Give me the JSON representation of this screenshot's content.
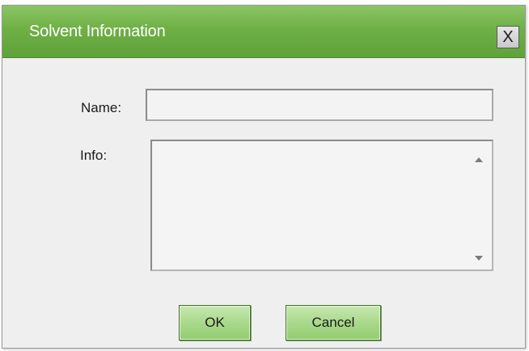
{
  "dialog": {
    "title": "Solvent Information",
    "close_label": "X"
  },
  "form": {
    "name_label": "Name:",
    "name_value": "",
    "info_label": "Info:",
    "info_value": ""
  },
  "buttons": {
    "ok_label": "OK",
    "cancel_label": "Cancel"
  },
  "colors": {
    "titlebar": "#6fb046",
    "button": "#a9d98b",
    "dialog_bg": "#efefef"
  },
  "icons": {
    "scroll_up": "scroll-up-arrow-icon",
    "scroll_down": "scroll-down-arrow-icon"
  }
}
